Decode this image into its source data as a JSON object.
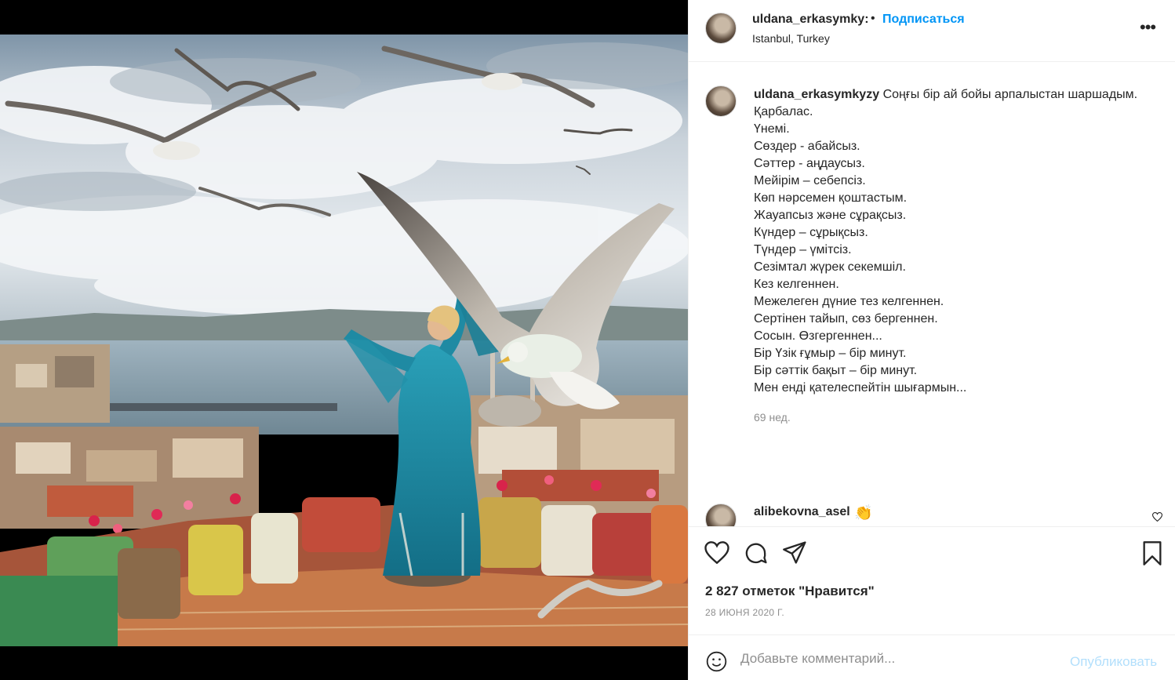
{
  "post": {
    "username": "uldana_erkasymky:",
    "dot": "•",
    "follow_label": "Подписаться",
    "location": "Istanbul, Turkey",
    "more_label": "•••"
  },
  "caption": {
    "username": "uldana_erkasymkyzy",
    "lines": [
      "Соңғы бір ай бойы арпалыстан шаршадым.",
      "Қарбалас.",
      "Үнемі.",
      "Сөздер - абайсыз.",
      "Сәттер - аңдаусыз.",
      "Мейірім – себепсіз.",
      "Көп нәрсемен қоштастым.",
      "Жауапсыз және сұрақсыз.",
      "Күндер – сұрықсыз.",
      "Түндер – үмітсіз.",
      "Сезімтал жүрек секемшіл.",
      "Кез келгеннен.",
      "Межелеген дүние тез келгеннен.",
      "Сертінен тайып, сөз бергеннен.",
      "Сосын. Өзгергеннен...",
      "Бір Үзік ғұмыр – бір минут.",
      "Бір сәттік бақыт – бір минут.",
      "Мен енді қателеспейтін шығармын..."
    ],
    "time": "69 нед."
  },
  "reply": {
    "username": "alibekovna_asel",
    "emoji": "👏"
  },
  "stats": {
    "likes": "2 827 отметок \"Нравится\"",
    "date": "28 ИЮНЯ 2020 Г."
  },
  "comment_box": {
    "placeholder": "Добавьте комментарий...",
    "publish_label": "Опубликовать"
  },
  "colors": {
    "accent": "#0095f6",
    "publish_disabled": "#b2dffc",
    "dress": "#1d8fa6"
  }
}
